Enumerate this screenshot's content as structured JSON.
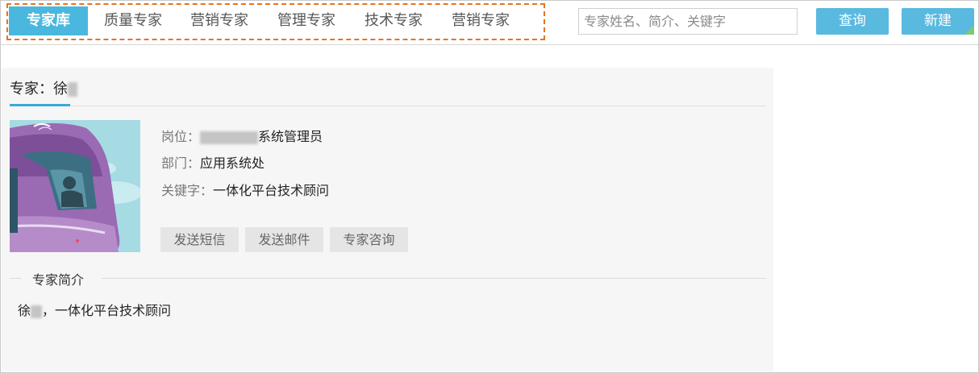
{
  "nav": {
    "tabs": [
      "专家库",
      "质量专家",
      "营销专家",
      "管理专家",
      "技术专家",
      "营销专家"
    ],
    "active_index": 0
  },
  "search": {
    "placeholder": "专家姓名、简介、关键字"
  },
  "buttons": {
    "query": "查询",
    "new": "新建"
  },
  "panel": {
    "title": "专家：徐",
    "position_label": "岗位：",
    "position_value": "系统管理员",
    "dept_label": "部门：",
    "dept_value": "应用系统处",
    "keyword_label": "关键字：",
    "keyword_value": "一体化平台技术顾问",
    "actions": [
      "发送短信",
      "发送邮件",
      "专家咨询"
    ],
    "intro_heading": "专家简介",
    "intro_name": "徐",
    "intro_text": "，一体化平台技术顾问"
  },
  "colors": {
    "accent": "#4ab8de",
    "highlight_border": "#e8731f",
    "underline": "#39a9d6"
  }
}
